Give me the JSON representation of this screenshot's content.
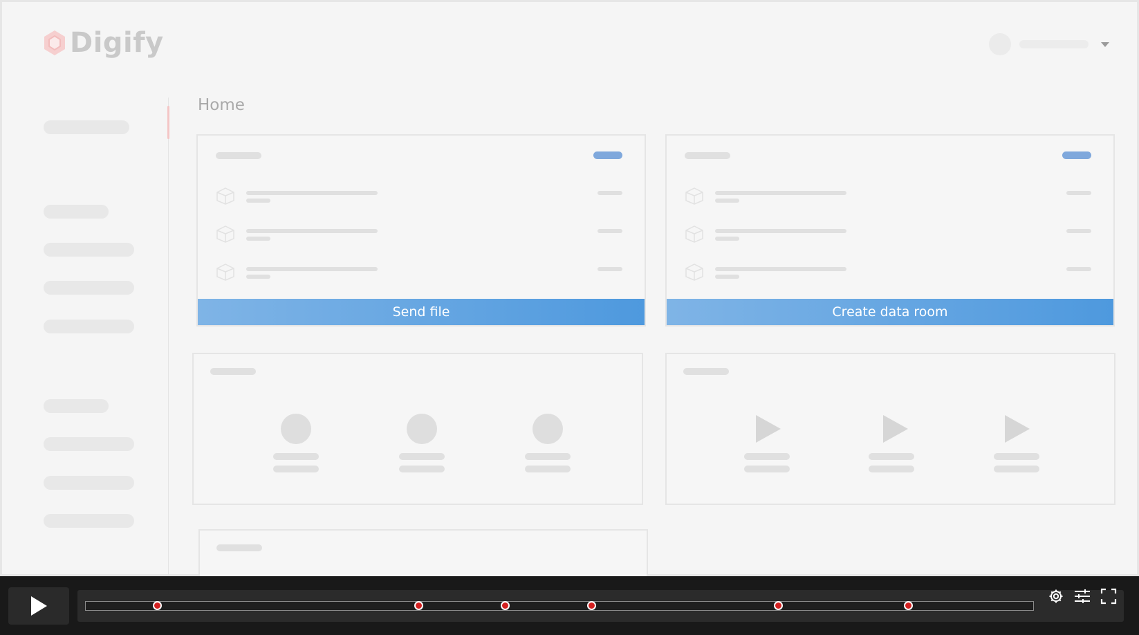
{
  "app": {
    "logo_text": "Digify"
  },
  "main": {
    "page_title": "Home"
  },
  "cards": {
    "send_file_label": "Send file",
    "create_data_room_label": "Create data room"
  },
  "colors": {
    "primary_blue": "#4e99de",
    "marker_red": "#d32020",
    "player_bg": "#191919"
  },
  "player": {
    "controls": [
      "play-icon",
      "gear-icon",
      "sliders-icon",
      "fullscreen-icon"
    ],
    "chapter_markers_fraction": [
      0.076,
      0.352,
      0.443,
      0.534,
      0.731,
      0.868
    ]
  }
}
